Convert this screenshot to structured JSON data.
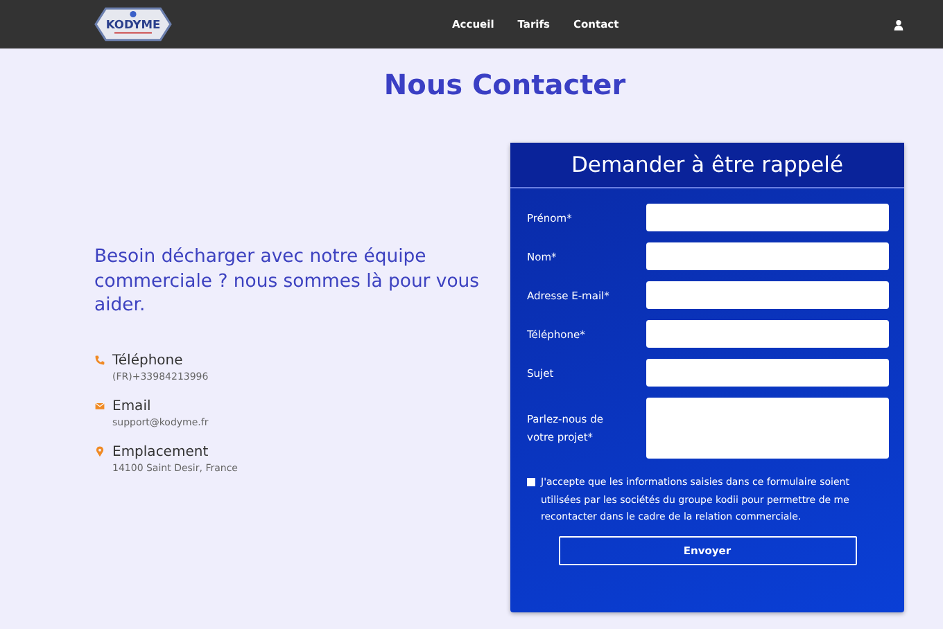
{
  "navbar": {
    "logo": {
      "text": "KODYME"
    },
    "links": [
      {
        "label": "Accueil"
      },
      {
        "label": "Tarifs"
      },
      {
        "label": "Contact"
      }
    ]
  },
  "title": "Nous Contacter",
  "intro": "Besoin décharger avec notre équipe commerciale ? nous sommes là pour vous aider.",
  "contacts": [
    {
      "kind": "phone",
      "label": "Téléphone",
      "value": "(FR)+33984213996"
    },
    {
      "kind": "email",
      "label": "Email",
      "value": "support@kodyme.fr"
    },
    {
      "kind": "location",
      "label": "Emplacement",
      "value": "14100 Saint Desir, France"
    }
  ],
  "form": {
    "title": "Demander à être rappelé",
    "fields": [
      {
        "kind": "input",
        "label": "Prénom*"
      },
      {
        "kind": "input",
        "label": "Nom*"
      },
      {
        "kind": "input",
        "label": "Adresse E-mail*"
      },
      {
        "kind": "input",
        "label": "Téléphone*"
      },
      {
        "kind": "input",
        "label": "Sujet"
      },
      {
        "kind": "textarea",
        "label": "Parlez-nous de votre projet*"
      }
    ],
    "consent": {
      "checked": false,
      "text": "J'accepte que les informations saisies dans ce formulaire soient utilisées par les sociétés du groupe kodii pour permettre de me recontacter dans le cadre de la relation commerciale."
    },
    "submit": "Envoyer"
  }
}
